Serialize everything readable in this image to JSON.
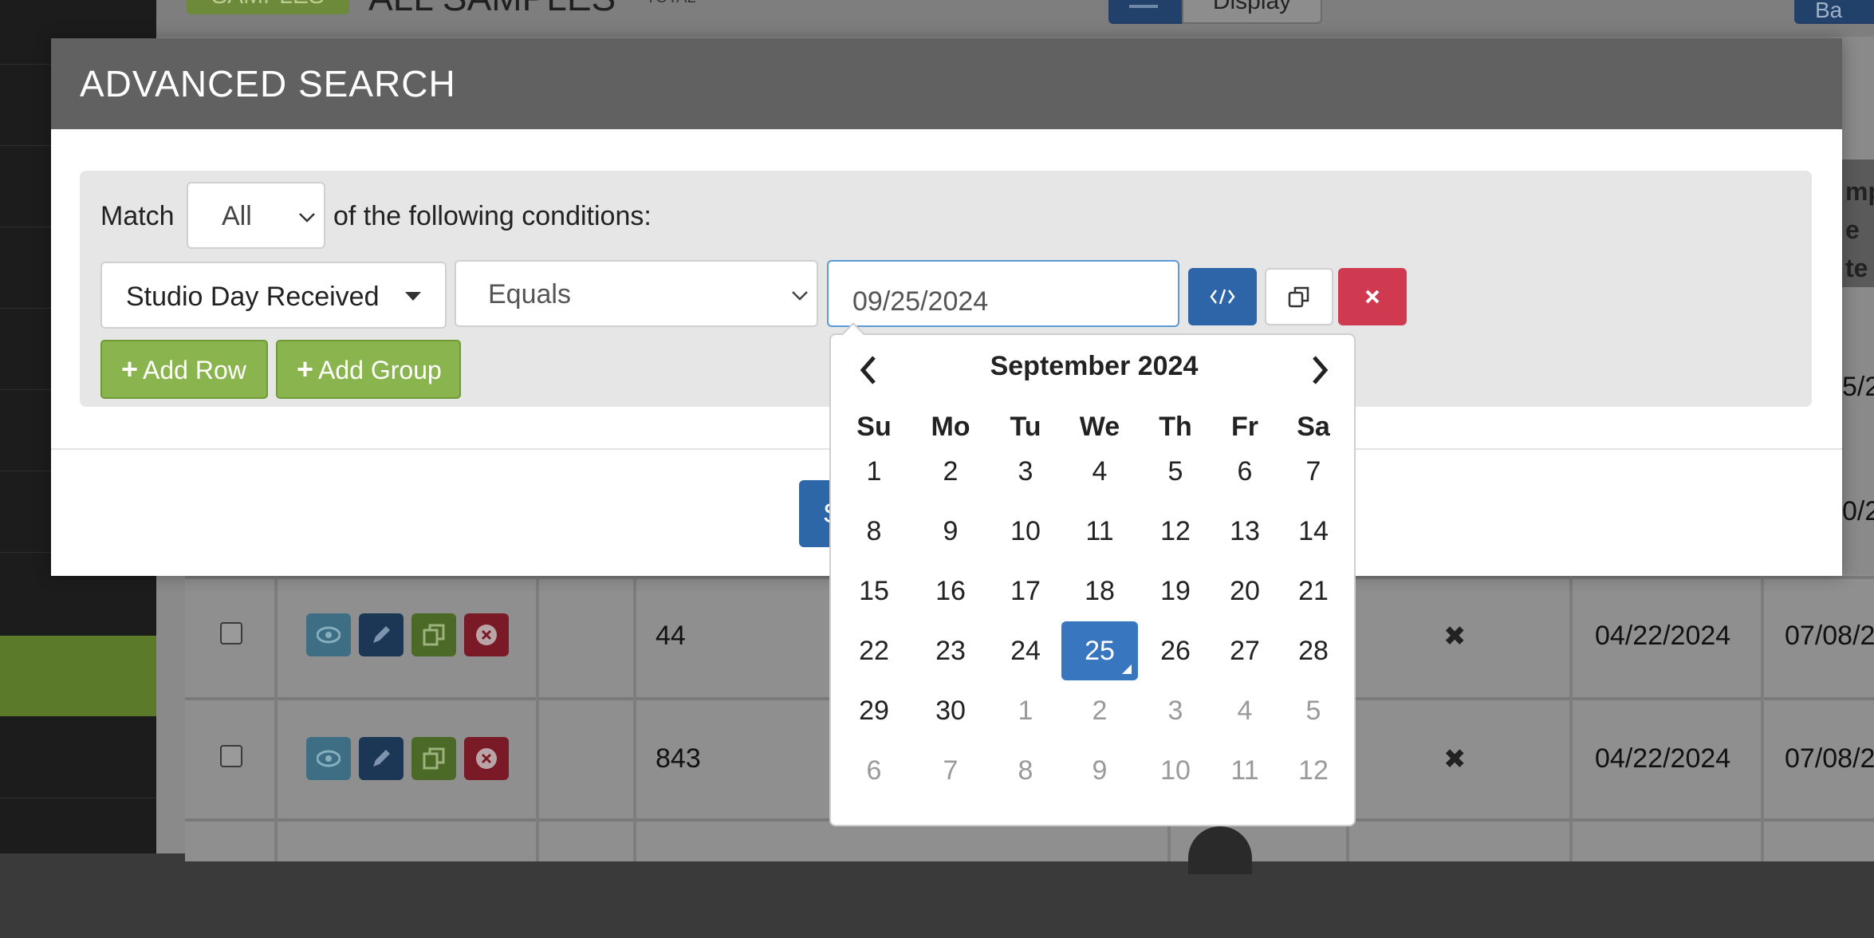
{
  "background": {
    "badge": "SAMPLES",
    "title": "ALL SAMPLES",
    "title_suffix": "TOTAL",
    "display_button": "Display",
    "right_button": "Ba",
    "right_header_fragment": "mp\ne\nte",
    "rows": [
      {
        "number": "44",
        "removed_icon": "✖",
        "date1": "04/22/2024",
        "date2": "07/08/2"
      },
      {
        "number": "843",
        "removed_icon": "✖",
        "date1": "04/22/2024",
        "date2": "07/08/2"
      }
    ],
    "right_fragments": [
      "5/2",
      "0/2"
    ]
  },
  "modal": {
    "title": "ADVANCED SEARCH",
    "match_label": "Match",
    "match_value": "All",
    "conditions_label": "of the following conditions:",
    "condition": {
      "field": "Studio Day Received",
      "operator": "Equals",
      "value": "09/25/2024"
    },
    "add_row_label": "Add Row",
    "add_group_label": "Add Group",
    "search_button_fragment": "S"
  },
  "datepicker": {
    "month_label": "September 2024",
    "weekdays": [
      "Su",
      "Mo",
      "Tu",
      "We",
      "Th",
      "Fr",
      "Sa"
    ],
    "weeks": [
      [
        {
          "d": "1"
        },
        {
          "d": "2"
        },
        {
          "d": "3"
        },
        {
          "d": "4"
        },
        {
          "d": "5"
        },
        {
          "d": "6"
        },
        {
          "d": "7"
        }
      ],
      [
        {
          "d": "8"
        },
        {
          "d": "9"
        },
        {
          "d": "10"
        },
        {
          "d": "11"
        },
        {
          "d": "12"
        },
        {
          "d": "13"
        },
        {
          "d": "14"
        }
      ],
      [
        {
          "d": "15"
        },
        {
          "d": "16"
        },
        {
          "d": "17"
        },
        {
          "d": "18"
        },
        {
          "d": "19"
        },
        {
          "d": "20"
        },
        {
          "d": "21"
        }
      ],
      [
        {
          "d": "22"
        },
        {
          "d": "23"
        },
        {
          "d": "24"
        },
        {
          "d": "25",
          "active": true
        },
        {
          "d": "26"
        },
        {
          "d": "27"
        },
        {
          "d": "28"
        }
      ],
      [
        {
          "d": "29"
        },
        {
          "d": "30"
        },
        {
          "d": "1",
          "muted": true
        },
        {
          "d": "2",
          "muted": true
        },
        {
          "d": "3",
          "muted": true
        },
        {
          "d": "4",
          "muted": true
        },
        {
          "d": "5",
          "muted": true
        }
      ],
      [
        {
          "d": "6",
          "muted": true
        },
        {
          "d": "7",
          "muted": true
        },
        {
          "d": "8",
          "muted": true
        },
        {
          "d": "9",
          "muted": true
        },
        {
          "d": "10",
          "muted": true
        },
        {
          "d": "11",
          "muted": true
        },
        {
          "d": "12",
          "muted": true
        }
      ]
    ]
  },
  "colors": {
    "primary": "#2d65a8",
    "success": "#8ab44d",
    "danger": "#d03a51",
    "active_day": "#3877c0"
  }
}
